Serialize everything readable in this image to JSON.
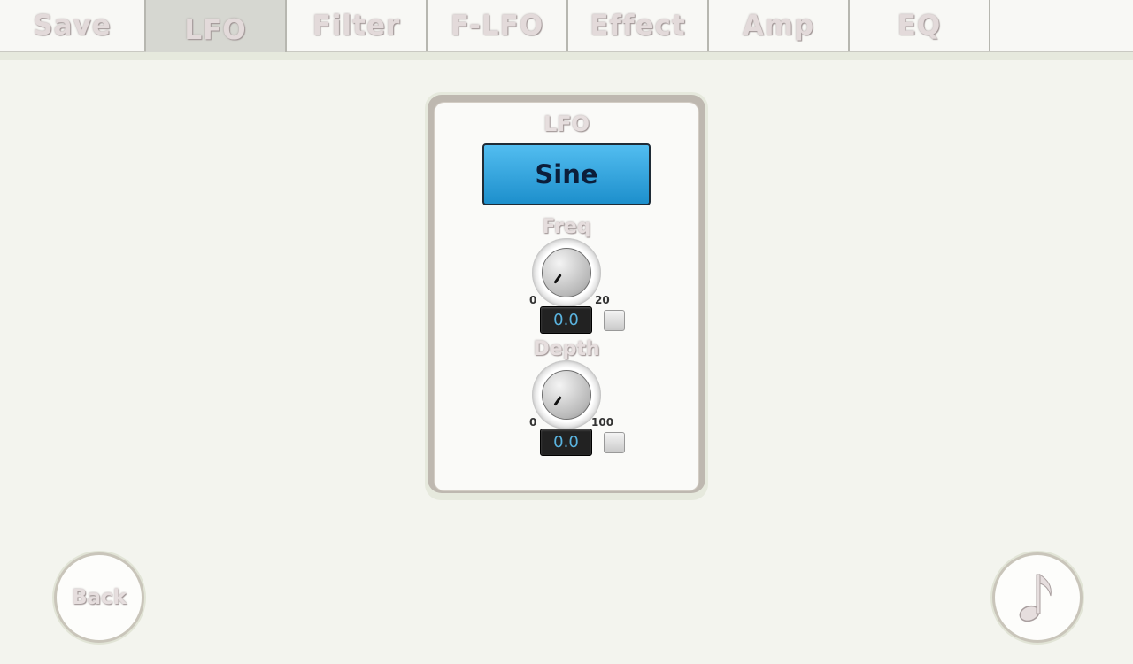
{
  "tabs": [
    {
      "label": "Save",
      "active": false
    },
    {
      "label": "LFO",
      "active": true
    },
    {
      "label": "Filter",
      "active": false
    },
    {
      "label": "F-LFO",
      "active": false
    },
    {
      "label": "Effect",
      "active": false
    },
    {
      "label": "Amp",
      "active": false
    },
    {
      "label": "EQ",
      "active": false
    }
  ],
  "panel": {
    "title": "LFO",
    "waveform": "Sine",
    "freq": {
      "label": "Freq",
      "min": "0",
      "max": "20",
      "value": "0.0"
    },
    "depth": {
      "label": "Depth",
      "min": "0",
      "max": "100",
      "value": "0.0"
    }
  },
  "footer": {
    "back_label": "Back",
    "note_icon": "music-note-icon"
  },
  "colors": {
    "accent": "#2aa3e0",
    "value_text": "#5ab4e0",
    "background": "#f3f4ee"
  }
}
